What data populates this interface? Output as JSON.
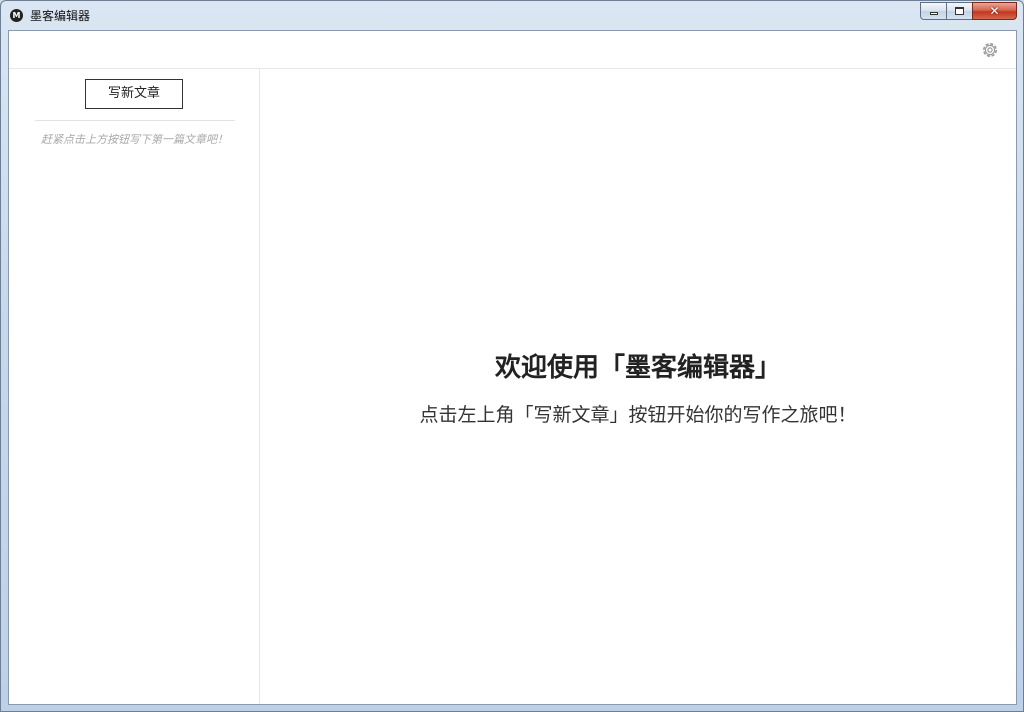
{
  "window": {
    "title": "墨客编辑器",
    "icon": "app-logo-icon",
    "controls": {
      "minimize": "minimize-icon",
      "maximize": "maximize-icon",
      "close": "close-icon",
      "close_glyph": "✕"
    }
  },
  "toolbar": {
    "settings_icon": "gear-icon"
  },
  "sidebar": {
    "new_post_label": "写新文章",
    "empty_hint": "赶紧点击上方按钮写下第一篇文章吧！"
  },
  "main": {
    "welcome_title": "欢迎使用「墨客编辑器」",
    "welcome_subtitle": "点击左上角「写新文章」按钮开始你的写作之旅吧！"
  },
  "colors": {
    "close_button": "#c2381f",
    "hint_text": "#a8a8a8",
    "border": "#e6e6e6"
  }
}
